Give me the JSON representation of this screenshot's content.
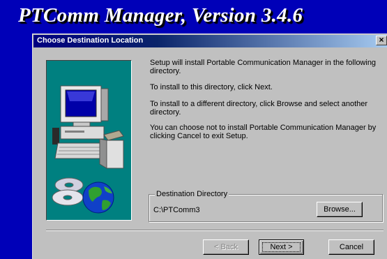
{
  "app": {
    "title": "PTComm Manager, Version 3.4.6"
  },
  "dialog": {
    "title": "Choose Destination Location",
    "close_glyph": "×",
    "messages": [
      "Setup will install Portable Communication Manager in the following directory.",
      "To install to this directory, click Next.",
      "To install to a different directory, click Browse and select another directory.",
      "You can choose not to install Portable Communication Manager by clicking Cancel to exit Setup."
    ],
    "destination": {
      "group_label": "Destination Directory",
      "path": "C:\\PTComm3",
      "browse_label": "Browse..."
    },
    "buttons": {
      "back_label": "< Back",
      "next_label": "Next >",
      "cancel_label": "Cancel"
    }
  },
  "icons": {
    "artwork": "computer-with-cds-and-globe-icon",
    "close": "close-icon"
  },
  "colors": {
    "desktop_background": "#0000b8",
    "dialog_face": "#c0c0c0",
    "titlebar_start": "#000080",
    "titlebar_end": "#a6caf0",
    "artwork_panel": "#008080"
  }
}
